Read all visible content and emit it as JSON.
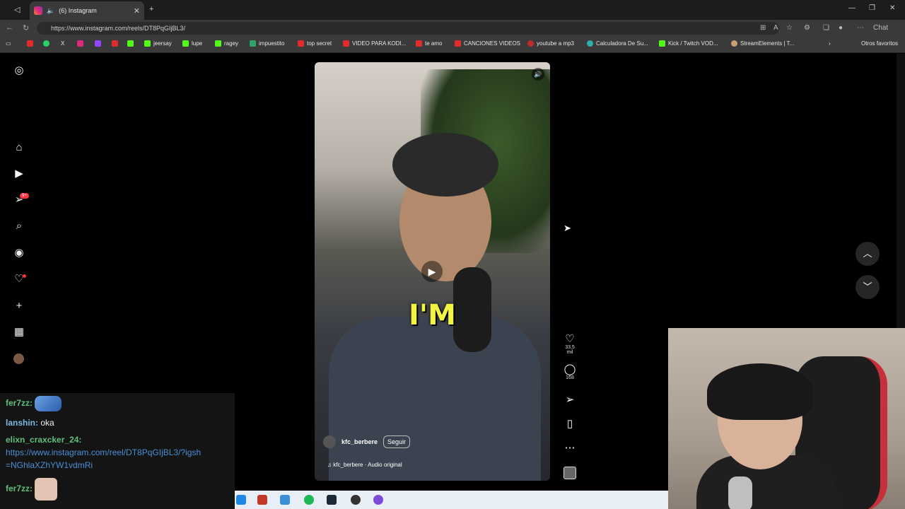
{
  "browser": {
    "tab_title": "(6) Instagram",
    "url": "https://www.instagram.com/reels/DT8PqGIjBL3/",
    "copilot_label": "Chat",
    "bookmarks": [
      {
        "label": "",
        "color": "#e22b2b"
      },
      {
        "label": "",
        "color": "#25d366"
      },
      {
        "label": "X",
        "color": "#ffffff"
      },
      {
        "label": "",
        "color": "#dd2a7b"
      },
      {
        "label": "",
        "color": "#9146ff"
      },
      {
        "label": "",
        "color": "#e22b2b"
      },
      {
        "label": "",
        "color": "#53fc18"
      },
      {
        "label": "jeersay",
        "color": "#53fc18"
      },
      {
        "label": "lupe",
        "color": "#53fc18"
      },
      {
        "label": "ragey",
        "color": "#53fc18"
      },
      {
        "label": "impuestito",
        "color": "#2fa36b"
      },
      {
        "label": "top secret",
        "color": "#e22b2b"
      },
      {
        "label": "VIDEO PARA KODI...",
        "color": "#e22b2b"
      },
      {
        "label": "te amo",
        "color": "#e22b2b"
      },
      {
        "label": "CANCIONES VIDEOS",
        "color": "#e22b2b"
      },
      {
        "label": "youtube a mp3",
        "color": "#c02b2b"
      },
      {
        "label": "Calculadora De Su...",
        "color": "#2bb0b0"
      },
      {
        "label": "Kick / Twitch VOD...",
        "color": "#53fc18"
      },
      {
        "label": "StreamElements | T...",
        "color": "#c8a070"
      }
    ],
    "other_favorites": "Otros favoritos"
  },
  "sidebar": {
    "notification_badge": "9+"
  },
  "reel": {
    "caption_text": "I'M",
    "author": "kfc_berbere",
    "follow_label": "Seguir",
    "audio": "kfc_berbere · Audio original",
    "likes": "33,5 mil",
    "comments": "168"
  },
  "chat": {
    "messages": [
      {
        "user": "fer7zz:",
        "text": ""
      },
      {
        "user": "lanshin:",
        "text": "oka"
      },
      {
        "user": "elixn_craxcker_24:",
        "text": ""
      },
      {
        "user": "",
        "text": "https://www.instagram.com/reel/DT8PqGIjBL3/?igsh"
      },
      {
        "user": "",
        "text": "=NGhlaXZhYW1vdmRi"
      },
      {
        "user": "fer7zz:",
        "text": ""
      }
    ]
  }
}
